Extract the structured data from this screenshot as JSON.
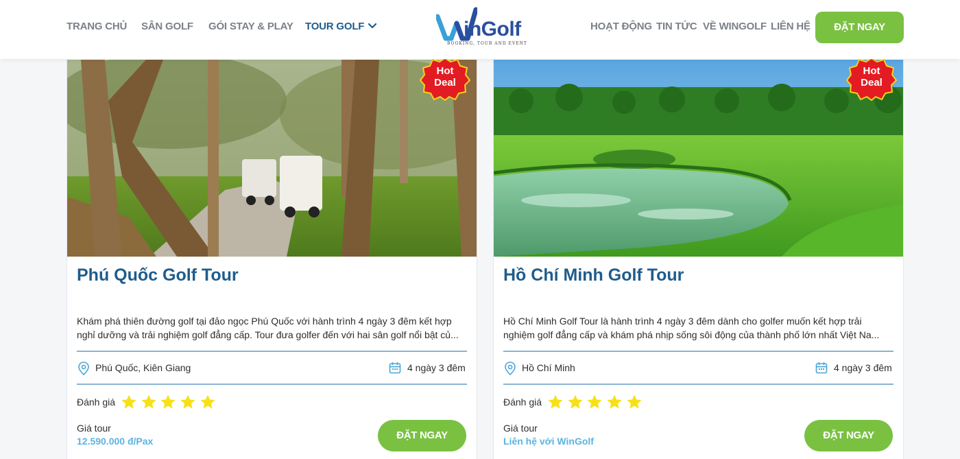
{
  "nav": {
    "left": [
      "TRANG CHỦ",
      "SÂN GOLF",
      "GÓI STAY & PLAY",
      "TOUR GOLF"
    ],
    "right": [
      "HOẠT ĐỘNG",
      "TIN TỨC",
      "VỀ WINGOLF",
      "LIÊN HỆ"
    ],
    "active": "TOUR GOLF",
    "cta": "ĐẶT NGAY"
  },
  "logo": {
    "text": "inGolf",
    "tagline": "BOOKING, TOUR AND EVENT"
  },
  "colors": {
    "primary": "#1f5c8c",
    "accent": "#7ac142",
    "hot": "#e31b23",
    "star": "#f7e017",
    "price": "#5ab4e0"
  },
  "cards": [
    {
      "badge": [
        "Hot",
        "Deal"
      ],
      "title": "Phú Quốc Golf Tour",
      "description": "Khám phá thiên đường golf tại đảo ngọc Phú Quốc với hành trình 4 ngày 3 đêm kết hợp nghỉ dưỡng và trải nghiệm golf đẳng cấp. Tour đưa golfer đến với hai sân golf nổi bật củ...",
      "location": "Phú Quốc, Kiên Giang",
      "duration": "4 ngày 3 đêm",
      "rating_label": "Đánh giá",
      "rating": 5,
      "price_label": "Giá tour",
      "price": "12.590.000 đ/Pax",
      "cta": "ĐẶT NGAY"
    },
    {
      "badge": [
        "Hot",
        "Deal"
      ],
      "title": "Hồ Chí Minh Golf Tour",
      "description": "Hồ Chí Minh Golf Tour là hành trình 4 ngày 3 đêm dành cho golfer muốn kết hợp trải nghiệm golf đẳng cấp và khám phá nhịp sống sôi động của thành phố lớn nhất Việt Na...",
      "location": "Hồ Chí Minh",
      "duration": "4 ngày 3 đêm",
      "rating_label": "Đánh giá",
      "rating": 5,
      "price_label": "Giá tour",
      "price": "Liên hệ với WinGolf",
      "cta": "ĐẶT NGAY"
    }
  ]
}
